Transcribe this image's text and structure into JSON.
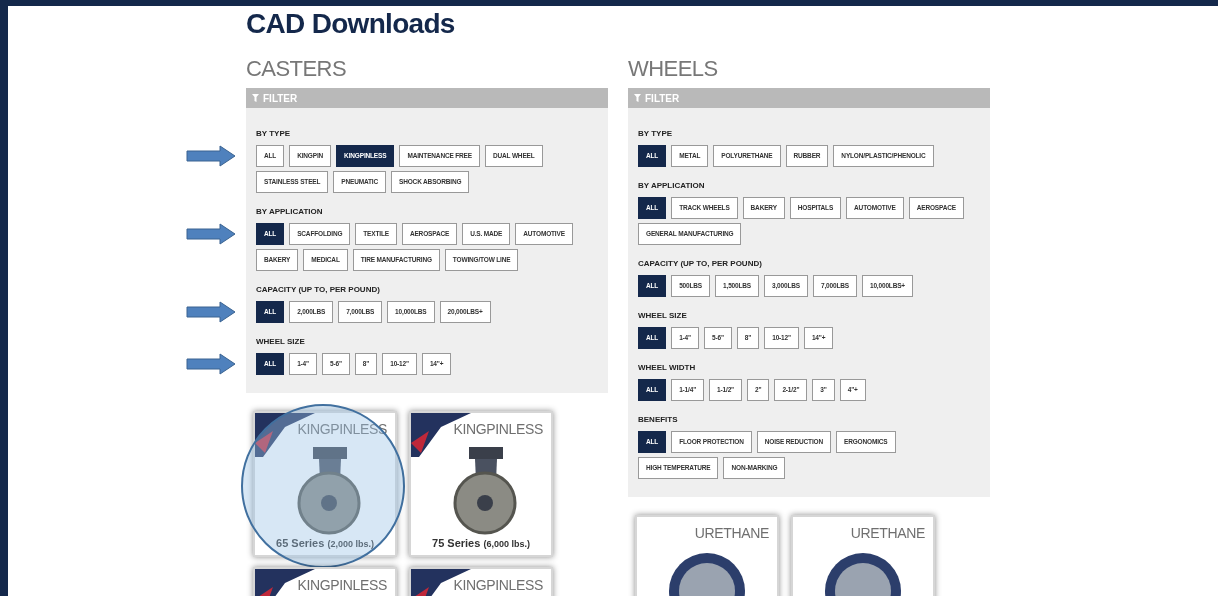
{
  "title": "CAD Downloads",
  "sections": [
    {
      "heading": "CASTERS",
      "filter_label": "FILTER",
      "groups": [
        {
          "label": "BY TYPE",
          "annotated": true,
          "options": [
            {
              "label": "ALL",
              "selected": false
            },
            {
              "label": "KINGPIN",
              "selected": false
            },
            {
              "label": "KINGPINLESS",
              "selected": true
            },
            {
              "label": "MAINTENANCE FREE",
              "selected": false
            },
            {
              "label": "DUAL WHEEL",
              "selected": false
            },
            {
              "label": "STAINLESS STEEL",
              "selected": false
            },
            {
              "label": "PNEUMATIC",
              "selected": false
            },
            {
              "label": "SHOCK ABSORBING",
              "selected": false
            }
          ]
        },
        {
          "label": "BY APPLICATION",
          "annotated": true,
          "options": [
            {
              "label": "ALL",
              "selected": true
            },
            {
              "label": "SCAFFOLDING",
              "selected": false
            },
            {
              "label": "TEXTILE",
              "selected": false
            },
            {
              "label": "AEROSPACE",
              "selected": false
            },
            {
              "label": "U.S. MADE",
              "selected": false
            },
            {
              "label": "AUTOMOTIVE",
              "selected": false
            },
            {
              "label": "BAKERY",
              "selected": false
            },
            {
              "label": "MEDICAL",
              "selected": false
            },
            {
              "label": "TIRE MANUFACTURING",
              "selected": false
            },
            {
              "label": "TOWING/TOW LINE",
              "selected": false
            }
          ]
        },
        {
          "label": "CAPACITY (UP TO, PER POUND)",
          "annotated": true,
          "options": [
            {
              "label": "ALL",
              "selected": true
            },
            {
              "label": "2,000LBS",
              "selected": false
            },
            {
              "label": "7,000LBS",
              "selected": false
            },
            {
              "label": "10,000LBS",
              "selected": false
            },
            {
              "label": "20,000LBS+",
              "selected": false
            }
          ]
        },
        {
          "label": "WHEEL SIZE",
          "annotated": true,
          "options": [
            {
              "label": "ALL",
              "selected": true
            },
            {
              "label": "1-4\"",
              "selected": false
            },
            {
              "label": "5-6\"",
              "selected": false
            },
            {
              "label": "8\"",
              "selected": false
            },
            {
              "label": "10-12\"",
              "selected": false
            },
            {
              "label": "14\"+",
              "selected": false
            }
          ]
        }
      ],
      "products": [
        {
          "kind": "caster",
          "badge": "KINGPINLESS",
          "made_in_usa": true,
          "highlighted": true,
          "caption": "65 Series",
          "capacity": "(2,000 lbs.)"
        },
        {
          "kind": "caster",
          "badge": "KINGPINLESS",
          "made_in_usa": true,
          "caption": "75 Series",
          "capacity": "(6,000 lbs.)"
        },
        {
          "kind": "caster",
          "badge": "KINGPINLESS",
          "made_in_usa": true
        },
        {
          "kind": "caster",
          "badge": "KINGPINLESS",
          "made_in_usa": true
        }
      ]
    },
    {
      "heading": "WHEELS",
      "filter_label": "FILTER",
      "groups": [
        {
          "label": "BY TYPE",
          "options": [
            {
              "label": "ALL",
              "selected": true
            },
            {
              "label": "METAL",
              "selected": false
            },
            {
              "label": "POLYURETHANE",
              "selected": false
            },
            {
              "label": "RUBBER",
              "selected": false
            },
            {
              "label": "NYLON/PLASTIC/PHENOLIC",
              "selected": false
            }
          ]
        },
        {
          "label": "BY APPLICATION",
          "options": [
            {
              "label": "ALL",
              "selected": true
            },
            {
              "label": "TRACK WHEELS",
              "selected": false
            },
            {
              "label": "BAKERY",
              "selected": false
            },
            {
              "label": "HOSPITALS",
              "selected": false
            },
            {
              "label": "AUTOMOTIVE",
              "selected": false
            },
            {
              "label": "AEROSPACE",
              "selected": false
            },
            {
              "label": "GENERAL MANUFACTURING",
              "selected": false
            }
          ]
        },
        {
          "label": "CAPACITY (UP TO, PER POUND)",
          "options": [
            {
              "label": "ALL",
              "selected": true
            },
            {
              "label": "500LBS",
              "selected": false
            },
            {
              "label": "1,500LBS",
              "selected": false
            },
            {
              "label": "3,000LBS",
              "selected": false
            },
            {
              "label": "7,000LBS",
              "selected": false
            },
            {
              "label": "10,000LBS+",
              "selected": false
            }
          ]
        },
        {
          "label": "WHEEL SIZE",
          "options": [
            {
              "label": "ALL",
              "selected": true
            },
            {
              "label": "1-4\"",
              "selected": false
            },
            {
              "label": "5-6\"",
              "selected": false
            },
            {
              "label": "8\"",
              "selected": false
            },
            {
              "label": "10-12\"",
              "selected": false
            },
            {
              "label": "14\"+",
              "selected": false
            }
          ]
        },
        {
          "label": "WHEEL WIDTH",
          "options": [
            {
              "label": "ALL",
              "selected": true
            },
            {
              "label": "1-1/4\"",
              "selected": false
            },
            {
              "label": "1-1/2\"",
              "selected": false
            },
            {
              "label": "2\"",
              "selected": false
            },
            {
              "label": "2-1/2\"",
              "selected": false
            },
            {
              "label": "3\"",
              "selected": false
            },
            {
              "label": "4\"+",
              "selected": false
            }
          ]
        },
        {
          "label": "BENEFITS",
          "options": [
            {
              "label": "ALL",
              "selected": true
            },
            {
              "label": "FLOOR PROTECTION",
              "selected": false
            },
            {
              "label": "NOISE REDUCTION",
              "selected": false
            },
            {
              "label": "ERGONOMICS",
              "selected": false
            },
            {
              "label": "HIGH TEMPERATURE",
              "selected": false
            },
            {
              "label": "NON-MARKING",
              "selected": false
            }
          ]
        }
      ],
      "products": [
        {
          "kind": "wheel",
          "badge": "URETHANE"
        },
        {
          "kind": "wheel",
          "badge": "URETHANE"
        }
      ]
    }
  ]
}
